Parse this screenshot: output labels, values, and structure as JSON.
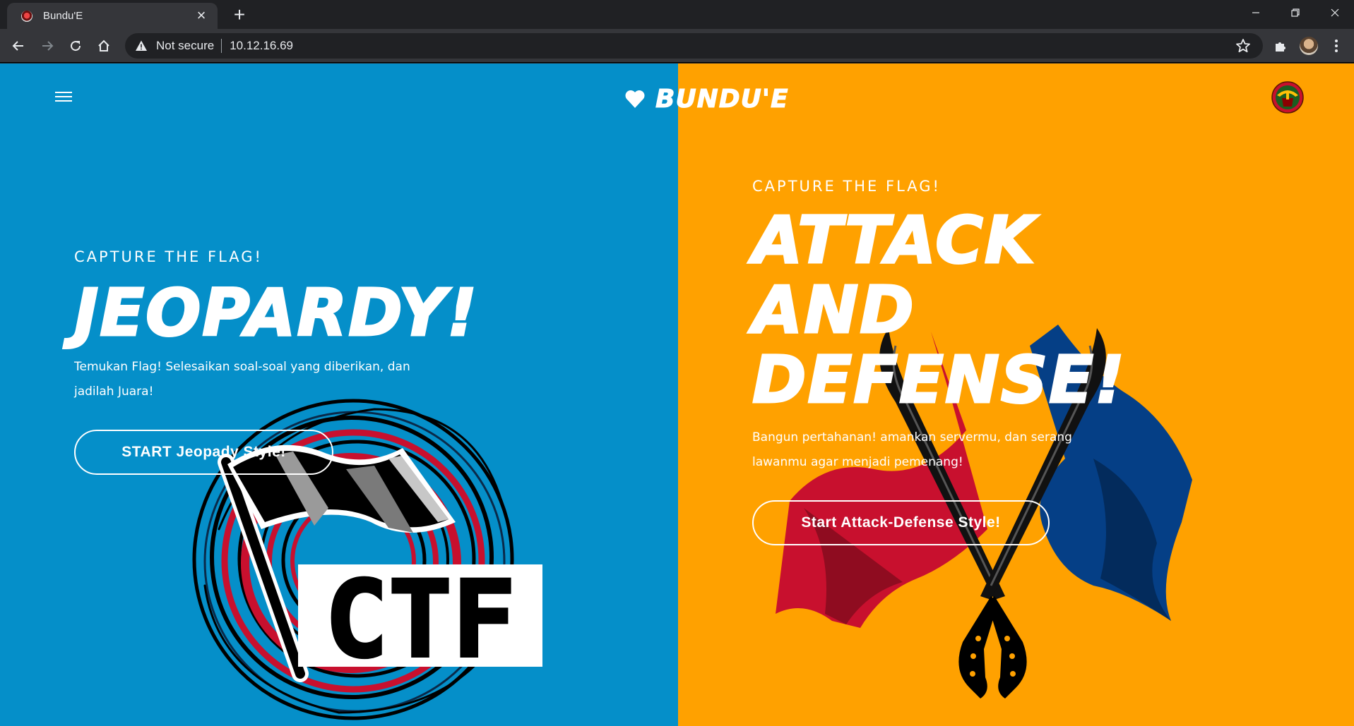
{
  "browser": {
    "tab_title": "Bundu'E",
    "security_label": "Not secure",
    "url": "10.12.16.69"
  },
  "header": {
    "brand_name": "BUNDU'E"
  },
  "jeopardy": {
    "eyebrow": "CAPTURE THE FLAG!",
    "title": "JEOPARDY!",
    "description_line1": "Temukan Flag! Selesaikan soal-soal yang diberikan, dan",
    "description_line2": "jadilah Juara!",
    "button_label": "START Jeopady Style!",
    "art_text": "CTF",
    "background_color": "#058fc9"
  },
  "attack_defense": {
    "eyebrow": "CAPTURE THE FLAG!",
    "title_line1": "ATTACK",
    "title_line2": "AND",
    "title_line3": "DEFENSE!",
    "description_line1": "Bangun pertahanan! amankan servermu, dan serang",
    "description_line2": "lawanmu agar menjadi pemenang!",
    "button_label": "Start Attack-Defense Style!",
    "background_color": "#ffa100"
  },
  "icons": [
    "favicon-icon",
    "close-icon",
    "plus-icon",
    "minimize-icon",
    "restore-icon",
    "back-icon",
    "forward-icon",
    "reload-icon",
    "home-icon",
    "warning-icon",
    "star-icon",
    "puzzle-icon",
    "kebab-menu-icon",
    "hamburger-icon",
    "heart-icon",
    "emblem-icon"
  ]
}
